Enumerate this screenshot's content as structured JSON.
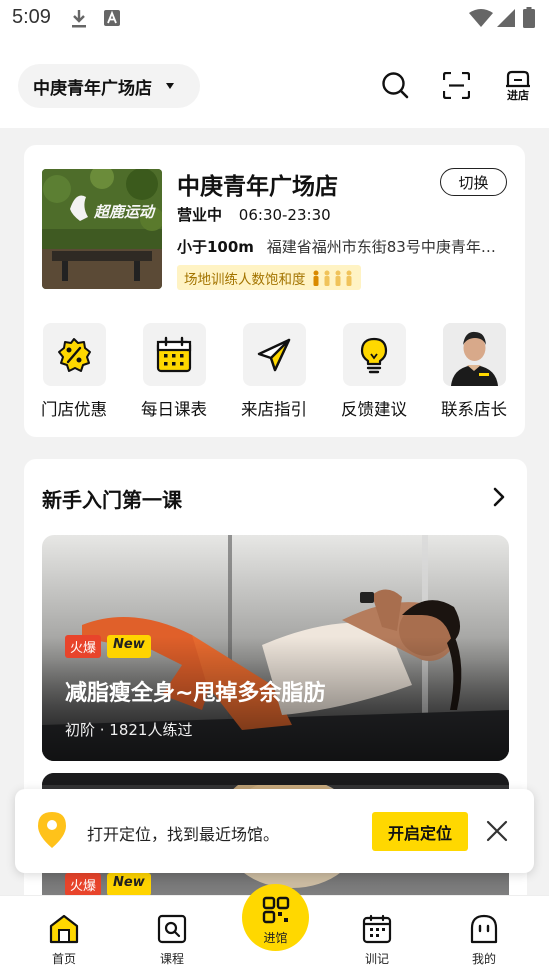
{
  "status_bar": {
    "time": "5:09"
  },
  "header": {
    "store_name": "中庚青年广场店",
    "enter_label": "进店"
  },
  "store_card": {
    "title": "中庚青年广场店",
    "switch_label": "切换",
    "status": "营业中",
    "hours": "06:30-23:30",
    "distance": "小于100m",
    "address": "福建省福州市东街83号中庚青年…",
    "crowd_label": "场地训练人数饱和度",
    "photo_sign": "超鹿运动"
  },
  "quick_actions": [
    {
      "label": "门店优惠",
      "icon": "discount-badge-icon"
    },
    {
      "label": "每日课表",
      "icon": "calendar-icon"
    },
    {
      "label": "来店指引",
      "icon": "paper-plane-icon"
    },
    {
      "label": "反馈建议",
      "icon": "lightbulb-icon"
    },
    {
      "label": "联系店长",
      "icon": "manager-avatar"
    }
  ],
  "beginner_section": {
    "title": "新手入门第一课",
    "courses": [
      {
        "tag_hot": "火爆",
        "tag_new": "New",
        "title": "减脂瘦全身~甩掉多余脂肪",
        "meta": "初阶 · 1821人练过"
      },
      {
        "tag_hot": "火爆",
        "tag_new": "New"
      }
    ]
  },
  "location_prompt": {
    "text": "打开定位，找到最近场馆。",
    "button_label": "开启定位"
  },
  "tabbar": {
    "items": [
      {
        "label": "首页",
        "active": true
      },
      {
        "label": "课程"
      },
      {
        "label": "进馆"
      },
      {
        "label": "训记"
      },
      {
        "label": "我的"
      }
    ]
  },
  "colors": {
    "accent": "#ffd800",
    "hot_tag": "#e8442b",
    "crowd_bg": "#fff3c4",
    "crowd_text": "#a37400"
  }
}
